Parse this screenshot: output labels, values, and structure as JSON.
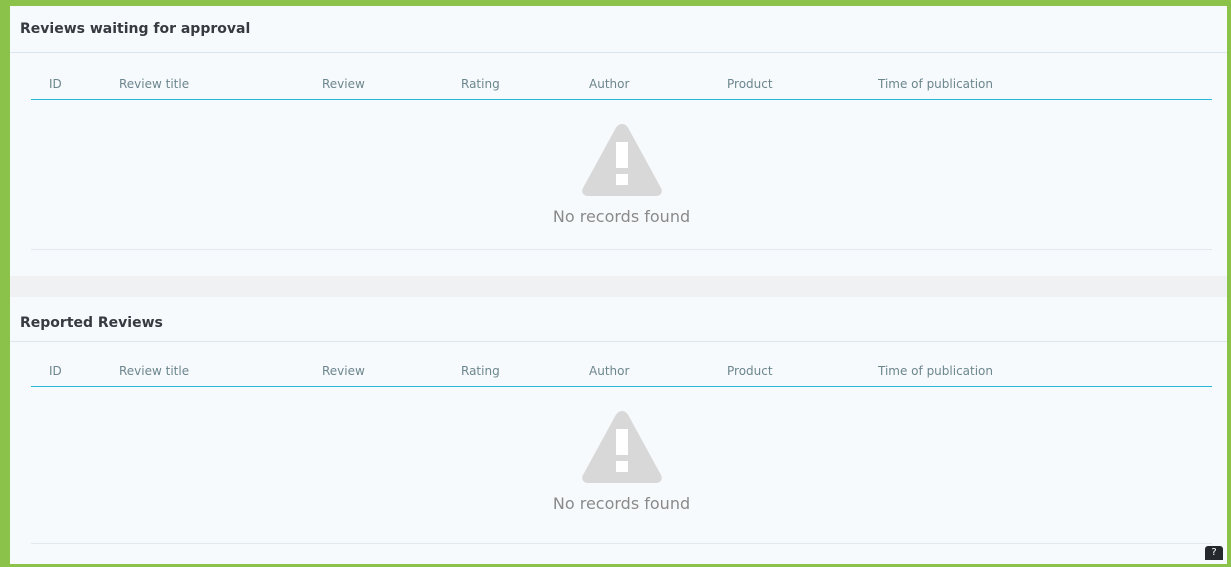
{
  "sections": [
    {
      "title": "Reviews waiting for approval",
      "columns": [
        "ID",
        "Review title",
        "Review",
        "Rating",
        "Author",
        "Product",
        "Time of publication"
      ],
      "empty_message": "No records found",
      "empty_icon": "warning-icon"
    },
    {
      "title": "Reported Reviews",
      "columns": [
        "ID",
        "Review title",
        "Review",
        "Rating",
        "Author",
        "Product",
        "Time of publication"
      ],
      "empty_message": "No records found",
      "empty_icon": "warning-icon"
    }
  ],
  "help": {
    "icon": "help-icon",
    "label": "?"
  },
  "colors": {
    "frame": "#8bc34a",
    "accent": "#25b9d7",
    "panel": "#f7fafc",
    "muted": "#6c868e"
  }
}
